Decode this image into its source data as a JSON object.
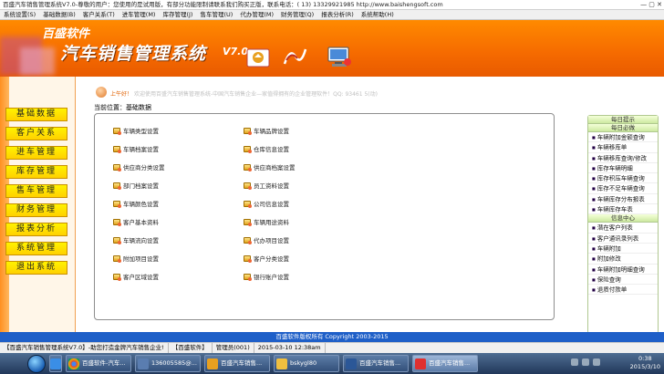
{
  "window": {
    "title": "百盛汽车销售管理系统V7.0-尊敬的用户：您使用的是试用版，有部分功能限制请联系我们购买正版，联系电话：( 13) 13329921985 http://www.baishengsoft.com",
    "controls": "— ▢ ✕"
  },
  "menu": [
    "系统设置(S)",
    "基础数据(B)",
    "客户关系(T)",
    "进车管理(M)",
    "库存管理(J)",
    "售车管理(U)",
    "代办管理(M)",
    "财务管理(Q)",
    "报表分析(R)",
    "系统帮助(H)"
  ],
  "banner": {
    "brand": "百盛软件",
    "product": "汽车销售管理系统",
    "version": "V7.0"
  },
  "sidebar": [
    "基础数据",
    "客户关系",
    "进车管理",
    "库存管理",
    "售车管理",
    "财务管理",
    "报表分析",
    "系统管理",
    "退出系统"
  ],
  "welcome": {
    "greeting": "上午好！",
    "text": "欢迎使用百盛汽车销售管理系统-中国汽车销售企业—家值得拥有的企业管理软件！QQ: 93461 5(动)"
  },
  "location": "当前位置：基础数据",
  "items_left": [
    "车辆类型设置",
    "车辆档案设置",
    "供应商分类设置",
    "部门档案设置",
    "车辆颜色设置",
    "客户基本资料",
    "车辆流向设置",
    "附加项目设置",
    "客户区域设置"
  ],
  "items_right": [
    "车辆品牌设置",
    "仓库信息设置",
    "供应商档案设置",
    "员工资料设置",
    "公司信息设置",
    "车辆用途资料",
    "代办项目设置",
    "客户分类设置",
    "银行账户设置"
  ],
  "right_panel": {
    "top_label": "每日提示",
    "header1": "每日必做",
    "list1": [
      "车辆附加金额查询",
      "车辆移库单",
      "车辆移库查询/修改",
      "库存车辆明细",
      "库存积压车辆查询",
      "库存不足车辆查询",
      "车辆库存分布报表",
      "车辆库存车表"
    ],
    "header2": "信息中心",
    "list2": [
      "潜在客户列表",
      "客户通讯录列表",
      "车辆附加",
      "附加修改",
      "车辆附加明细查询",
      "保险查询",
      "退质付款单"
    ]
  },
  "copyright": "百盛软件版权所有 Copyright 2003-2015",
  "status": [
    "【百盛汽车销售管理系统V7.0】-助您打造金牌汽车销售企业!",
    "【百盛软件】",
    "管理员(001)",
    "2015-03-10 12:38am"
  ],
  "taskbar": {
    "items": [
      "百盛软件-汽车...",
      "136005585@...",
      "百盛汽车销售...",
      "bskygl80",
      "百盛汽车销售...",
      "百盛汽车销售..."
    ],
    "time": "0:38",
    "date": "2015/3/10"
  },
  "colors": {
    "banner": "#f56a00",
    "nav_button": "#ffe000",
    "copyright_bar": "#1e5fc8"
  }
}
